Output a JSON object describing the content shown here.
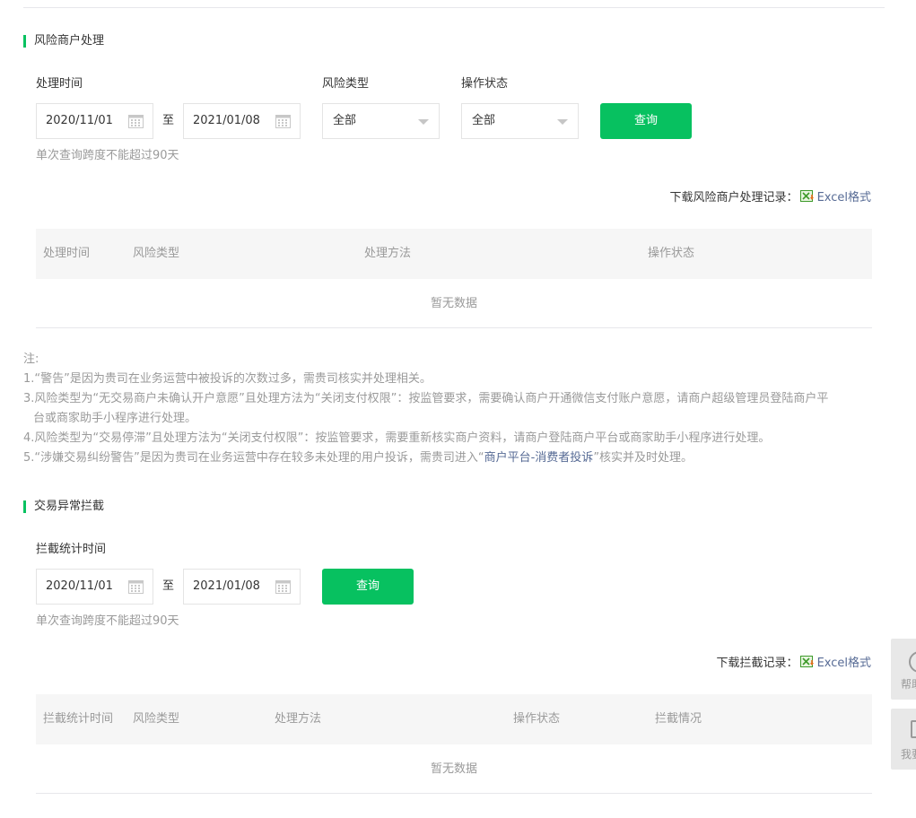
{
  "risk_section": {
    "title": "风险商户处理",
    "time_label": "处理时间",
    "start_date": "2020/11/01",
    "to_label": "至",
    "end_date": "2021/01/08",
    "risk_type_label": "风险类型",
    "risk_type_value": "全部",
    "op_status_label": "操作状态",
    "op_status_value": "全部",
    "query_label": "查询",
    "hint": "单次查询跨度不能超过90天",
    "download_label": "下载风险商户处理记录：",
    "excel_label": "Excel格式",
    "table_headers": [
      "处理时间",
      "风险类型",
      "处理方法",
      "操作状态"
    ],
    "empty_text": "暂无数据"
  },
  "notes": {
    "heading": "注:",
    "line1": "1.“警告”是因为贵司在业务运营中被投诉的次数过多，需贵司核实并处理相关。",
    "line3": "3.风险类型为“无交易商户未确认开户意愿”且处理方法为“关闭支付权限”：按监管要求，需要确认商户开通微信支付账户意愿，请商户超级管理员登陆商户平",
    "line3_cont": "台或商家助手小程序进行处理。",
    "line4": "4.风险类型为“交易停滞”且处理方法为“关闭支付权限”：按监管要求，需要重新核实商户资料，请商户登陆商户平台或商家助手小程序进行处理。",
    "line5_pre": "5.“涉嫌交易纠纷警告”是因为贵司在业务运营中存在较多未处理的用户投诉，需贵司进入“",
    "line5_link": "商户平台-消费者投诉",
    "line5_post": "”核实并及时处理。"
  },
  "intercept_section": {
    "title": "交易异常拦截",
    "time_label": "拦截统计时间",
    "start_date": "2020/11/01",
    "to_label": "至",
    "end_date": "2021/01/08",
    "query_label": "查询",
    "hint": "单次查询跨度不能超过90天",
    "download_label": "下载拦截记录：",
    "excel_label": "Excel格式",
    "table_headers": [
      "拦截统计时间",
      "风险类型",
      "处理方法",
      "操作状态",
      "拦截情况"
    ],
    "empty_text": "暂无数据"
  },
  "side_tabs": {
    "help": "帮助",
    "feedback": "我要"
  },
  "icons": {
    "calendar": "calendar-icon",
    "dropdown": "caret-down-icon",
    "excel": "excel-icon",
    "help": "help-circle-icon",
    "feedback": "feedback-icon"
  },
  "colors": {
    "accent": "#07c160",
    "link": "#576b95",
    "muted": "#9a9a9a",
    "text": "#353535"
  }
}
